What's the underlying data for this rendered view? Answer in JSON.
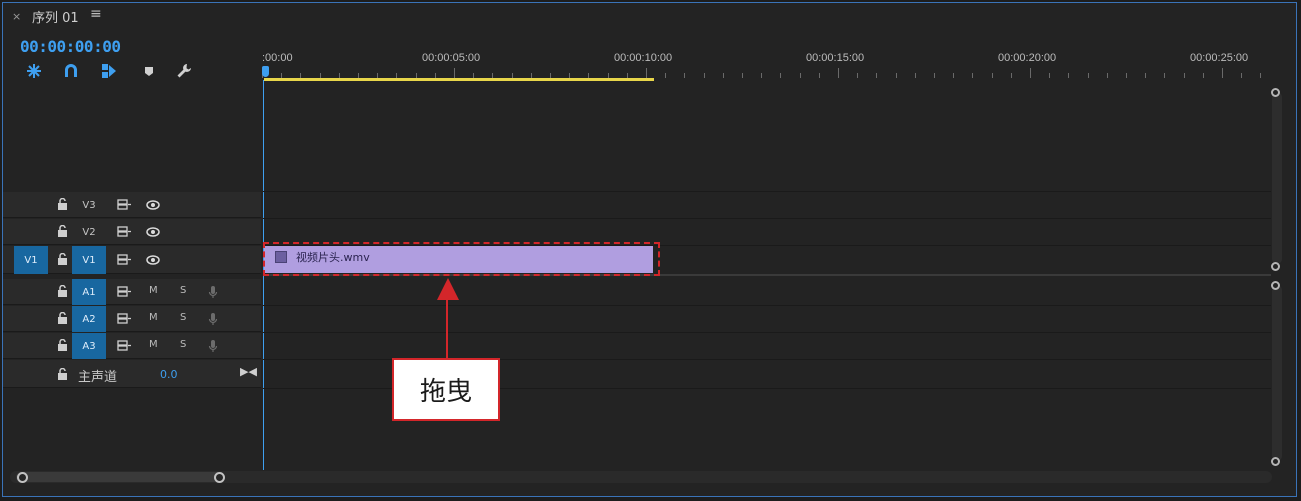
{
  "panel": {
    "close_glyph": "×",
    "title": "序列 01",
    "menu_glyph": "≡"
  },
  "timecode": "00:00:00:00",
  "tools": [
    "nest-snap-icon",
    "magnet-icon",
    "linked-selection-icon",
    "marker-icon",
    "wrench-icon"
  ],
  "ruler": {
    "labels": [
      ":00:00",
      "00:00:05:00",
      "00:00:10:00",
      "00:00:15:00",
      "00:00:20:00",
      "00:00:25:00"
    ]
  },
  "video_tracks": [
    {
      "id": "V3",
      "active": false
    },
    {
      "id": "V2",
      "active": false
    },
    {
      "id": "V1",
      "active": true,
      "source": "V1"
    }
  ],
  "audio_tracks": [
    {
      "id": "A1",
      "mute": "M",
      "solo": "S"
    },
    {
      "id": "A2",
      "mute": "M",
      "solo": "S"
    },
    {
      "id": "A3",
      "mute": "M",
      "solo": "S"
    }
  ],
  "master": {
    "label": "主声道",
    "value": "0.0"
  },
  "clip": {
    "name": "视频片头.wmv",
    "color": "#b09ee0"
  },
  "annotation": {
    "text": "拖曳",
    "color": "#d3262a"
  },
  "colors": {
    "accent": "#3e9ff0",
    "work_area": "#e8d64a",
    "track_active": "#1867a0"
  }
}
